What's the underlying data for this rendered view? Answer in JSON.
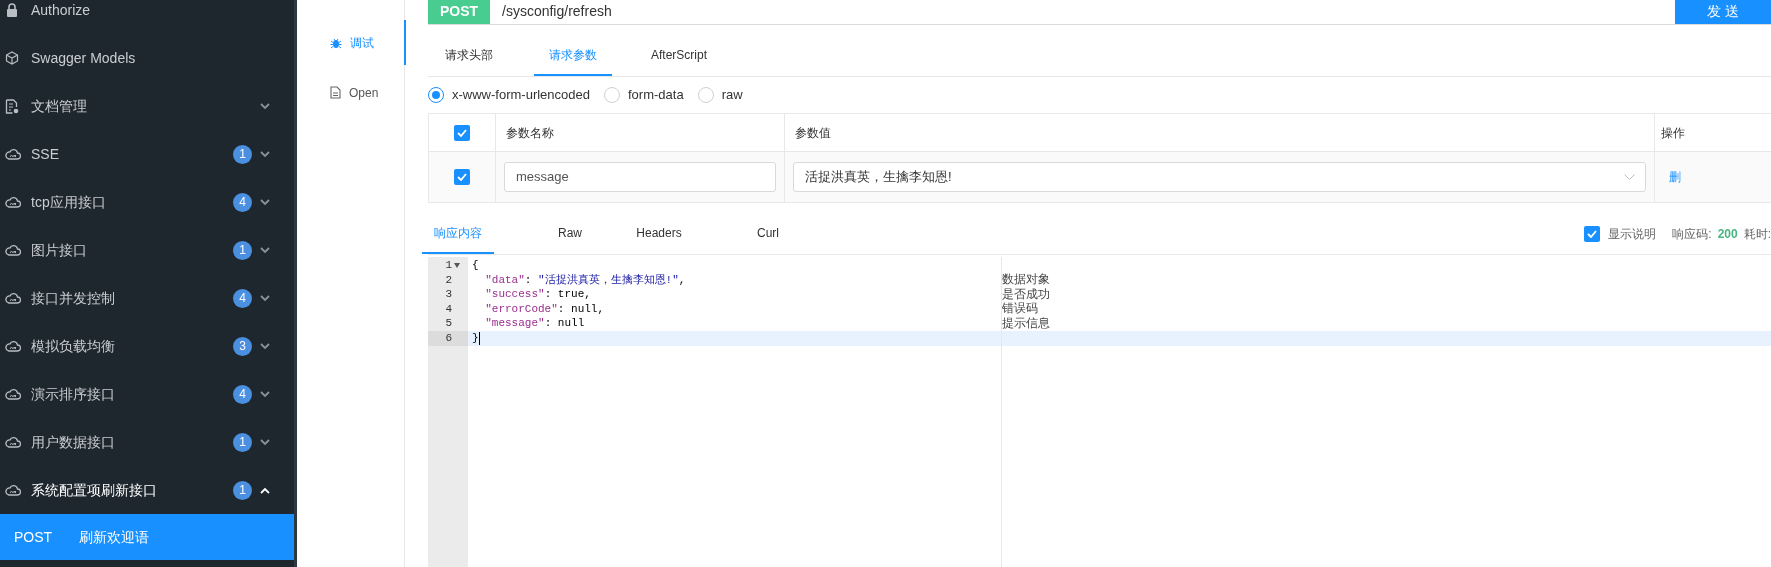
{
  "sidebar": {
    "items": [
      {
        "kind": "lock",
        "label": "Authorize"
      },
      {
        "kind": "models",
        "label": "Swagger Models"
      },
      {
        "kind": "docs",
        "label": "文档管理",
        "expanded": false
      },
      {
        "kind": "group",
        "label": "SSE",
        "badge": "1",
        "expanded": false
      },
      {
        "kind": "group",
        "label": "tcp应用接口",
        "badge": "4",
        "expanded": false
      },
      {
        "kind": "group",
        "label": "图片接口",
        "badge": "1",
        "expanded": false
      },
      {
        "kind": "group",
        "label": "接口并发控制",
        "badge": "4",
        "expanded": false
      },
      {
        "kind": "group",
        "label": "模拟负载均衡",
        "badge": "3",
        "expanded": false
      },
      {
        "kind": "group",
        "label": "演示排序接口",
        "badge": "4",
        "expanded": false
      },
      {
        "kind": "group",
        "label": "用户数据接口",
        "badge": "1",
        "expanded": false
      },
      {
        "kind": "group",
        "label": "系统配置项刷新接口",
        "badge": "1",
        "expanded": true,
        "children": [
          {
            "method": "POST",
            "label": "刷新欢迎语",
            "selected": true
          }
        ]
      }
    ]
  },
  "side_tabs": [
    {
      "kind": "debug",
      "label": "调试",
      "selected": true
    },
    {
      "kind": "doc",
      "label": "Open",
      "selected": false
    }
  ],
  "request": {
    "method": "POST",
    "url": "/sysconfig/refresh",
    "send_button": "发 送"
  },
  "request_tabs": [
    {
      "label": "请求头部",
      "selected": false
    },
    {
      "label": "请求参数",
      "selected": true
    },
    {
      "label": "AfterScript",
      "selected": false
    }
  ],
  "body_types": [
    {
      "label": "x-www-form-urlencoded",
      "selected": true
    },
    {
      "label": "form-data",
      "selected": false
    },
    {
      "label": "raw",
      "selected": false
    }
  ],
  "params": {
    "all_checked": true,
    "columns": [
      "参数名称",
      "参数值",
      "操作"
    ],
    "rows": [
      {
        "checked": true,
        "name": "message",
        "value": "活捉洪真英，生擒李知恩!",
        "action": "删"
      }
    ]
  },
  "response_tabs": [
    {
      "label": "响应内容",
      "selected": true
    },
    {
      "label": "Raw",
      "selected": false
    },
    {
      "label": "Headers",
      "selected": false
    },
    {
      "label": "Curl",
      "selected": false
    }
  ],
  "response_meta": {
    "show_description": true,
    "show_description_label": "显示说明",
    "code_label": "响应码:",
    "code": "200",
    "time_label": "耗时:"
  },
  "editor": {
    "lines": [
      {
        "number": "1",
        "active": false,
        "tokens": [
          {
            "kind": "punct",
            "text": "{"
          }
        ]
      },
      {
        "number": "2",
        "active": false,
        "note": "数据对象",
        "tokens": [
          {
            "kind": "key",
            "text": "  \"data\""
          },
          {
            "kind": "punct",
            "text": ": "
          },
          {
            "kind": "string",
            "text": "\"活捉洪真英，生擒李知恩!\""
          },
          {
            "kind": "punct",
            "text": ","
          }
        ]
      },
      {
        "number": "3",
        "active": false,
        "note": "是否成功",
        "tokens": [
          {
            "kind": "key",
            "text": "  \"success\""
          },
          {
            "kind": "punct",
            "text": ": true,"
          }
        ]
      },
      {
        "number": "4",
        "active": false,
        "note": "错误码",
        "tokens": [
          {
            "kind": "key",
            "text": "  \"errorCode\""
          },
          {
            "kind": "punct",
            "text": ": null,"
          }
        ]
      },
      {
        "number": "5",
        "active": false,
        "note": "提示信息",
        "tokens": [
          {
            "kind": "key",
            "text": "  \"message\""
          },
          {
            "kind": "punct",
            "text": ": null"
          }
        ]
      },
      {
        "number": "6",
        "active": true,
        "tokens": [
          {
            "kind": "punct",
            "text": "}"
          }
        ]
      }
    ]
  }
}
